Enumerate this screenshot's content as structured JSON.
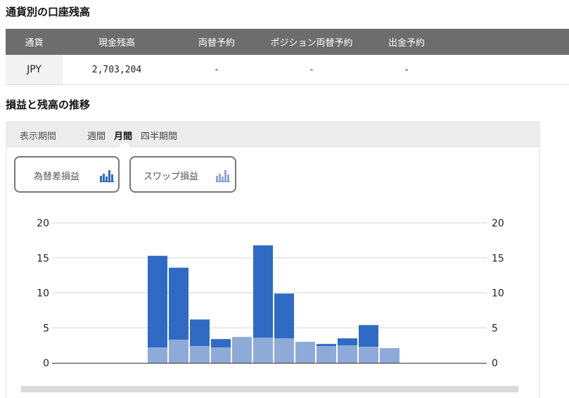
{
  "sections": {
    "balance_title": "通貨別の口座残高",
    "trend_title": "損益と残高の推移"
  },
  "balance_table": {
    "headers": [
      "通貨",
      "現金残高",
      "両替予約",
      "ポジション両替予約",
      "出金予約"
    ],
    "row": {
      "currency": "JPY",
      "cash_balance": "2,703,204",
      "exchange_reservation": "-",
      "position_exchange_reservation": "-",
      "withdrawal_reservation": "-"
    }
  },
  "period": {
    "label": "表示期間",
    "tabs": [
      "週間",
      "月間",
      "四半期間"
    ],
    "active": "月間"
  },
  "toggles": {
    "fx_label": "為替差損益",
    "swap_label": "スワップ損益",
    "fx_icon": "bar-chart-icon",
    "swap_icon": "bar-chart-icon"
  },
  "colors": {
    "fx": "#2f6bc4",
    "swap": "#8eaad8",
    "header_bg": "#6d6d6d"
  },
  "chart_data": {
    "type": "bar",
    "stacked": true,
    "ylim": [
      0,
      20
    ],
    "yticks": [
      "0",
      "5",
      "10",
      "15",
      "20"
    ],
    "series": [
      {
        "values": [
          0,
          0,
          0,
          0,
          0,
          13.1,
          10.3,
          3.8,
          1.2,
          0,
          13.2,
          6.4,
          0,
          0.3,
          1.0,
          3.1,
          0,
          0,
          0,
          0,
          0,
          0
        ]
      },
      {
        "values": [
          0,
          0,
          0,
          0,
          0,
          2.2,
          3.3,
          2.4,
          2.2,
          3.7,
          3.6,
          3.5,
          3.0,
          2.4,
          2.5,
          2.3,
          2.1,
          0,
          0,
          0,
          0,
          0
        ]
      }
    ],
    "grid": true
  }
}
